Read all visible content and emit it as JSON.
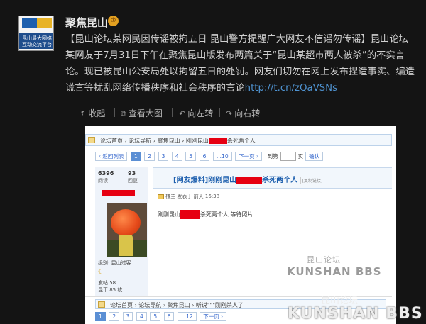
{
  "account": {
    "name": "聚焦昆山",
    "vip_glyph": "♔",
    "avatar_logo_text": "昆山BBS",
    "avatar_caption_1": "昆山最大网络",
    "avatar_caption_2": "互动交流平台"
  },
  "post": {
    "text": "【昆山论坛某网民因传谣被拘五日 昆山警方提醒广大网友不信谣勿传谣】昆山论坛某网友于7月31日下午在聚焦昆山版发布两篇关于“昆山某超市两人被杀”的不实言论。现已被昆山公安局处以拘留五日的处罚。网友们切勿在网上发布捏造事实、编造谎言等扰乱网络传播秩序和社会秩序的言论",
    "link": "http://t.cn/zQaVSNs"
  },
  "toolbar": {
    "collapse": "收起",
    "view_large": "查看大图",
    "rotate_left": "向左转",
    "rotate_right": "向右转"
  },
  "screenshot": {
    "breadcrumb_pre": "论坛首页 › 论坛导航 › 聚焦昆山 › 刚刚昆山",
    "breadcrumb_post": "杀死两个人",
    "pager": {
      "back": "‹ 返回列表",
      "pages": [
        "1",
        "2",
        "3",
        "4",
        "5",
        "6",
        "...10",
        "下一页 ›"
      ],
      "goto": "到第",
      "page_unit": "页",
      "confirm": "确认"
    },
    "stats": [
      {
        "num": "6396",
        "label": "阅读"
      },
      {
        "num": "93",
        "label": "回复"
      }
    ],
    "member": {
      "level": "级别: 昆山过客",
      "posts": "发帖    58",
      "coins": "昆币    85 枚"
    },
    "title_prefix": "[网友爆料]刚刚昆山",
    "title_suffix": "杀死两个人",
    "title_badge": "[复制链接]",
    "floor_info": "楼主   发表于 前天 16:38",
    "body_pre": "刚刚昆山",
    "body_post": "杀死两个人   等待照片",
    "watermark_small_cn": "昆山论坛",
    "watermark_small_en": "KUNSHAN BBS",
    "breadcrumb2": "论坛首页 › 论坛导航 › 聚焦昆山 › 听说\"\"\"刚刚杀人了",
    "pager2": [
      "1",
      "2",
      "3",
      "4",
      "5",
      "6",
      "...12",
      "下一页 ›"
    ]
  },
  "watermark": {
    "cn": "昆山论坛",
    "en": "KUNSHAN BBS"
  }
}
